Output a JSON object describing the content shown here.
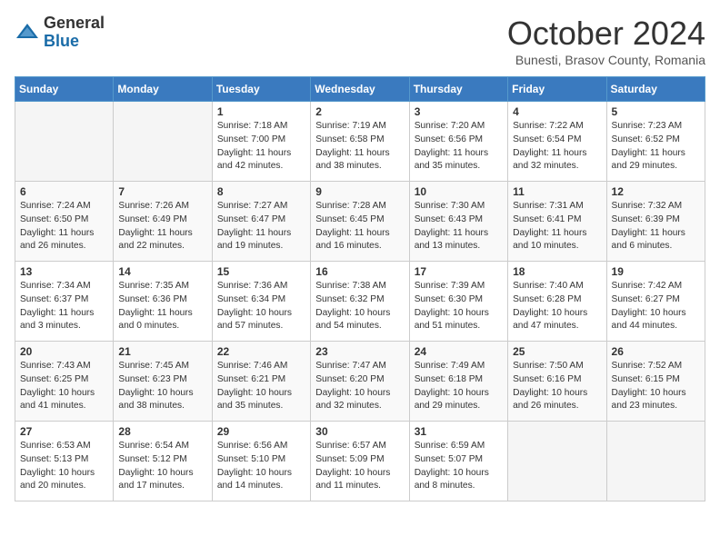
{
  "logo": {
    "general": "General",
    "blue": "Blue"
  },
  "title": "October 2024",
  "subtitle": "Bunesti, Brasov County, Romania",
  "days_header": [
    "Sunday",
    "Monday",
    "Tuesday",
    "Wednesday",
    "Thursday",
    "Friday",
    "Saturday"
  ],
  "weeks": [
    [
      {
        "day": "",
        "info": ""
      },
      {
        "day": "",
        "info": ""
      },
      {
        "day": "1",
        "info": "Sunrise: 7:18 AM\nSunset: 7:00 PM\nDaylight: 11 hours and 42 minutes."
      },
      {
        "day": "2",
        "info": "Sunrise: 7:19 AM\nSunset: 6:58 PM\nDaylight: 11 hours and 38 minutes."
      },
      {
        "day": "3",
        "info": "Sunrise: 7:20 AM\nSunset: 6:56 PM\nDaylight: 11 hours and 35 minutes."
      },
      {
        "day": "4",
        "info": "Sunrise: 7:22 AM\nSunset: 6:54 PM\nDaylight: 11 hours and 32 minutes."
      },
      {
        "day": "5",
        "info": "Sunrise: 7:23 AM\nSunset: 6:52 PM\nDaylight: 11 hours and 29 minutes."
      }
    ],
    [
      {
        "day": "6",
        "info": "Sunrise: 7:24 AM\nSunset: 6:50 PM\nDaylight: 11 hours and 26 minutes."
      },
      {
        "day": "7",
        "info": "Sunrise: 7:26 AM\nSunset: 6:49 PM\nDaylight: 11 hours and 22 minutes."
      },
      {
        "day": "8",
        "info": "Sunrise: 7:27 AM\nSunset: 6:47 PM\nDaylight: 11 hours and 19 minutes."
      },
      {
        "day": "9",
        "info": "Sunrise: 7:28 AM\nSunset: 6:45 PM\nDaylight: 11 hours and 16 minutes."
      },
      {
        "day": "10",
        "info": "Sunrise: 7:30 AM\nSunset: 6:43 PM\nDaylight: 11 hours and 13 minutes."
      },
      {
        "day": "11",
        "info": "Sunrise: 7:31 AM\nSunset: 6:41 PM\nDaylight: 11 hours and 10 minutes."
      },
      {
        "day": "12",
        "info": "Sunrise: 7:32 AM\nSunset: 6:39 PM\nDaylight: 11 hours and 6 minutes."
      }
    ],
    [
      {
        "day": "13",
        "info": "Sunrise: 7:34 AM\nSunset: 6:37 PM\nDaylight: 11 hours and 3 minutes."
      },
      {
        "day": "14",
        "info": "Sunrise: 7:35 AM\nSunset: 6:36 PM\nDaylight: 11 hours and 0 minutes."
      },
      {
        "day": "15",
        "info": "Sunrise: 7:36 AM\nSunset: 6:34 PM\nDaylight: 10 hours and 57 minutes."
      },
      {
        "day": "16",
        "info": "Sunrise: 7:38 AM\nSunset: 6:32 PM\nDaylight: 10 hours and 54 minutes."
      },
      {
        "day": "17",
        "info": "Sunrise: 7:39 AM\nSunset: 6:30 PM\nDaylight: 10 hours and 51 minutes."
      },
      {
        "day": "18",
        "info": "Sunrise: 7:40 AM\nSunset: 6:28 PM\nDaylight: 10 hours and 47 minutes."
      },
      {
        "day": "19",
        "info": "Sunrise: 7:42 AM\nSunset: 6:27 PM\nDaylight: 10 hours and 44 minutes."
      }
    ],
    [
      {
        "day": "20",
        "info": "Sunrise: 7:43 AM\nSunset: 6:25 PM\nDaylight: 10 hours and 41 minutes."
      },
      {
        "day": "21",
        "info": "Sunrise: 7:45 AM\nSunset: 6:23 PM\nDaylight: 10 hours and 38 minutes."
      },
      {
        "day": "22",
        "info": "Sunrise: 7:46 AM\nSunset: 6:21 PM\nDaylight: 10 hours and 35 minutes."
      },
      {
        "day": "23",
        "info": "Sunrise: 7:47 AM\nSunset: 6:20 PM\nDaylight: 10 hours and 32 minutes."
      },
      {
        "day": "24",
        "info": "Sunrise: 7:49 AM\nSunset: 6:18 PM\nDaylight: 10 hours and 29 minutes."
      },
      {
        "day": "25",
        "info": "Sunrise: 7:50 AM\nSunset: 6:16 PM\nDaylight: 10 hours and 26 minutes."
      },
      {
        "day": "26",
        "info": "Sunrise: 7:52 AM\nSunset: 6:15 PM\nDaylight: 10 hours and 23 minutes."
      }
    ],
    [
      {
        "day": "27",
        "info": "Sunrise: 6:53 AM\nSunset: 5:13 PM\nDaylight: 10 hours and 20 minutes."
      },
      {
        "day": "28",
        "info": "Sunrise: 6:54 AM\nSunset: 5:12 PM\nDaylight: 10 hours and 17 minutes."
      },
      {
        "day": "29",
        "info": "Sunrise: 6:56 AM\nSunset: 5:10 PM\nDaylight: 10 hours and 14 minutes."
      },
      {
        "day": "30",
        "info": "Sunrise: 6:57 AM\nSunset: 5:09 PM\nDaylight: 10 hours and 11 minutes."
      },
      {
        "day": "31",
        "info": "Sunrise: 6:59 AM\nSunset: 5:07 PM\nDaylight: 10 hours and 8 minutes."
      },
      {
        "day": "",
        "info": ""
      },
      {
        "day": "",
        "info": ""
      }
    ]
  ]
}
